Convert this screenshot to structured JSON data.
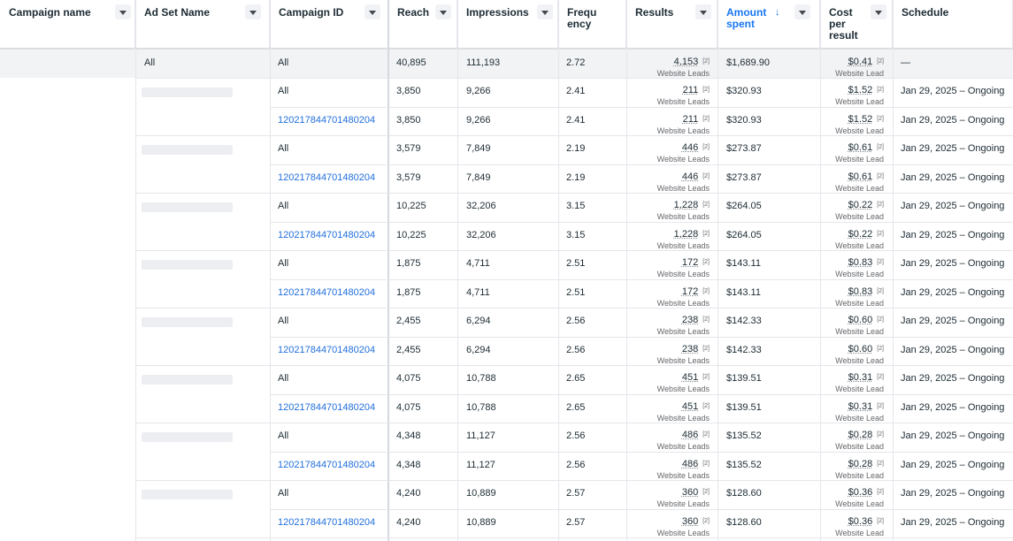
{
  "columns": [
    {
      "key": "campaign_name",
      "label": "Campaign name"
    },
    {
      "key": "ad_set_name",
      "label": "Ad Set Name"
    },
    {
      "key": "campaign_id",
      "label": "Campaign ID"
    },
    {
      "key": "reach",
      "label": "Reach"
    },
    {
      "key": "impressions",
      "label": "Impressions"
    },
    {
      "key": "frequency",
      "label": "Frequ\nency"
    },
    {
      "key": "results",
      "label": "Results"
    },
    {
      "key": "amount_spent",
      "label": "Amount\nspent"
    },
    {
      "key": "cost_per_result",
      "label": "Cost\nper\nresult"
    },
    {
      "key": "schedule",
      "label": "Schedule"
    }
  ],
  "sort_indicator": "↓",
  "attribution_marker": "[2]",
  "summary": {
    "ad_set": "All",
    "campaign_id": "All",
    "reach": "40,895",
    "impressions": "111,193",
    "frequency": "2.72",
    "results": "4,153",
    "results_label": "Website Leads",
    "amount_spent": "$1,689.90",
    "cost_per_result": "$0.41",
    "cost_label": "Website Lead",
    "schedule": "—"
  },
  "groups": [
    {
      "campaign_id": "120217844701480204",
      "reach": "3,850",
      "impressions": "9,266",
      "frequency": "2.41",
      "results": "211",
      "amount_spent": "$320.93",
      "cost_per_result": "$1.52"
    },
    {
      "campaign_id": "120217844701480204",
      "reach": "3,579",
      "impressions": "7,849",
      "frequency": "2.19",
      "results": "446",
      "amount_spent": "$273.87",
      "cost_per_result": "$0.61"
    },
    {
      "campaign_id": "120217844701480204",
      "reach": "10,225",
      "impressions": "32,206",
      "frequency": "3.15",
      "results": "1,228",
      "amount_spent": "$264.05",
      "cost_per_result": "$0.22"
    },
    {
      "campaign_id": "120217844701480204",
      "reach": "1,875",
      "impressions": "4,711",
      "frequency": "2.51",
      "results": "172",
      "amount_spent": "$143.11",
      "cost_per_result": "$0.83"
    },
    {
      "campaign_id": "120217844701480204",
      "reach": "2,455",
      "impressions": "6,294",
      "frequency": "2.56",
      "results": "238",
      "amount_spent": "$142.33",
      "cost_per_result": "$0.60"
    },
    {
      "campaign_id": "120217844701480204",
      "reach": "4,075",
      "impressions": "10,788",
      "frequency": "2.65",
      "results": "451",
      "amount_spent": "$139.51",
      "cost_per_result": "$0.31"
    },
    {
      "campaign_id": "120217844701480204",
      "reach": "4,348",
      "impressions": "11,127",
      "frequency": "2.56",
      "results": "486",
      "amount_spent": "$135.52",
      "cost_per_result": "$0.28"
    },
    {
      "campaign_id": "120217844701480204",
      "reach": "4,240",
      "impressions": "10,889",
      "frequency": "2.57",
      "results": "360",
      "amount_spent": "$128.60",
      "cost_per_result": "$0.36"
    }
  ],
  "row_defaults": {
    "all_label": "All",
    "results_label": "Website Leads",
    "cost_label": "Website Lead",
    "schedule": "Jan 29, 2025 – Ongoing"
  },
  "colors": {
    "link": "#216fdb",
    "active_header": "#1877f2",
    "summary_bg": "#f2f3f5"
  }
}
